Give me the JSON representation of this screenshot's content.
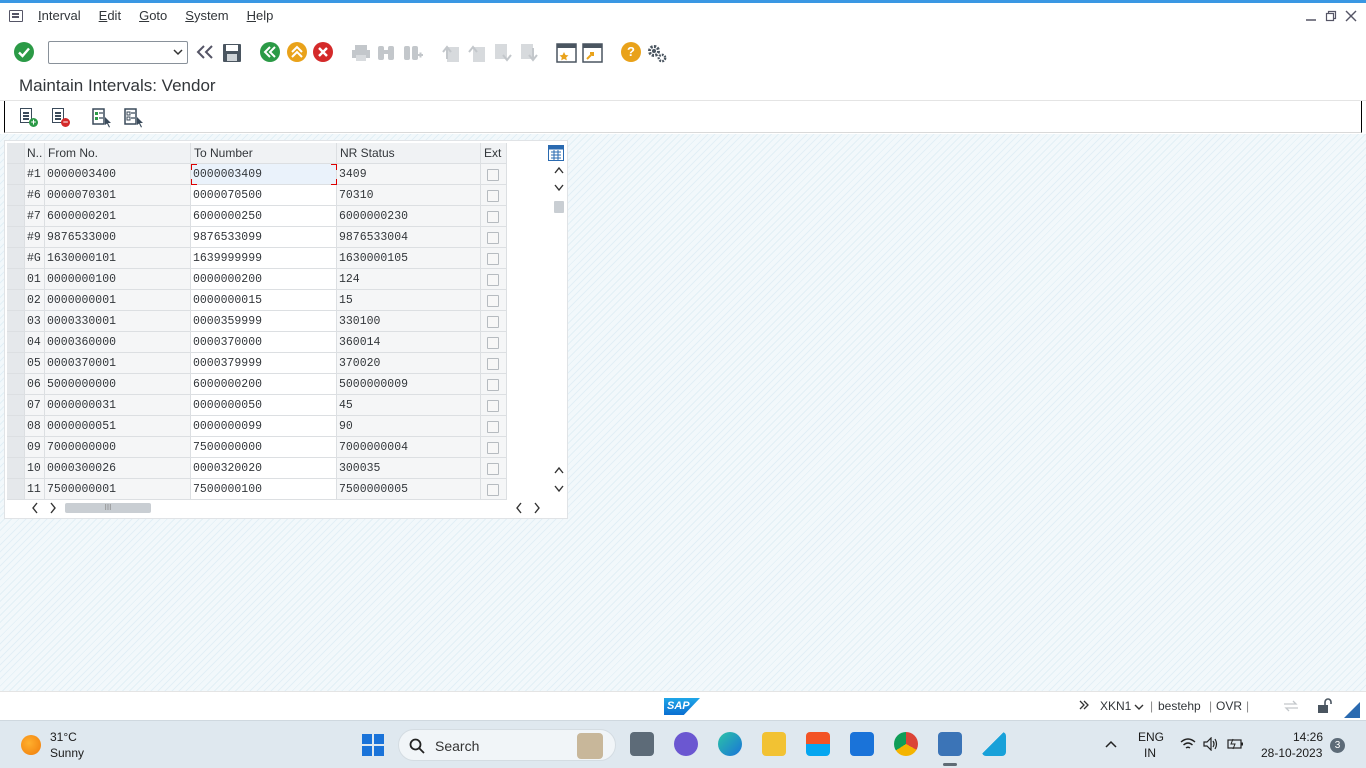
{
  "menu": {
    "items": [
      {
        "label": "Interval",
        "u": "I",
        "rest": "nterval"
      },
      {
        "label": "Edit",
        "u": "E",
        "rest": "dit"
      },
      {
        "label": "Goto",
        "u": "G",
        "rest": "oto"
      },
      {
        "label": "System",
        "u": "S",
        "rest": "ystem"
      },
      {
        "label": "Help",
        "u": "H",
        "rest": "elp"
      }
    ]
  },
  "toolbar": {
    "command_value": ""
  },
  "title": "Maintain Intervals: Vendor",
  "table": {
    "headers": {
      "num": "N..",
      "from": "From No.",
      "to": "To Number",
      "status": "NR Status",
      "ext": "Ext"
    },
    "rows": [
      {
        "num": "#1",
        "from": "0000003400",
        "to": "0000003409",
        "status": "3409"
      },
      {
        "num": "#6",
        "from": "0000070301",
        "to": "0000070500",
        "status": "70310"
      },
      {
        "num": "#7",
        "from": "6000000201",
        "to": "6000000250",
        "status": "6000000230"
      },
      {
        "num": "#9",
        "from": "9876533000",
        "to": "9876533099",
        "status": "9876533004"
      },
      {
        "num": "#G",
        "from": "1630000101",
        "to": "1639999999",
        "status": "1630000105"
      },
      {
        "num": "01",
        "from": "0000000100",
        "to": "0000000200",
        "status": "124"
      },
      {
        "num": "02",
        "from": "0000000001",
        "to": "0000000015",
        "status": "15"
      },
      {
        "num": "03",
        "from": "0000330001",
        "to": "0000359999",
        "status": "330100"
      },
      {
        "num": "04",
        "from": "0000360000",
        "to": "0000370000",
        "status": "360014"
      },
      {
        "num": "05",
        "from": "0000370001",
        "to": "0000379999",
        "status": "370020"
      },
      {
        "num": "06",
        "from": "5000000000",
        "to": "6000000200",
        "status": "5000000009"
      },
      {
        "num": "07",
        "from": "0000000031",
        "to": "0000000050",
        "status": "45"
      },
      {
        "num": "08",
        "from": "0000000051",
        "to": "0000000099",
        "status": "90"
      },
      {
        "num": "09",
        "from": "7000000000",
        "to": "7500000000",
        "status": "7000000004"
      },
      {
        "num": "10",
        "from": "0000300026",
        "to": "0000320020",
        "status": "300035"
      },
      {
        "num": "11",
        "from": "7500000001",
        "to": "7500000100",
        "status": "7500000005"
      }
    ]
  },
  "statusbar": {
    "logo": "SAP",
    "transaction": "XKN1",
    "server": "bestehp",
    "mode": "OVR"
  },
  "taskbar": {
    "temperature": "31°C",
    "weather": "Sunny",
    "search_label": "Search",
    "lang": "ENG",
    "region": "IN",
    "time": "14:26",
    "date": "28-10-2023",
    "notifications": "3"
  }
}
